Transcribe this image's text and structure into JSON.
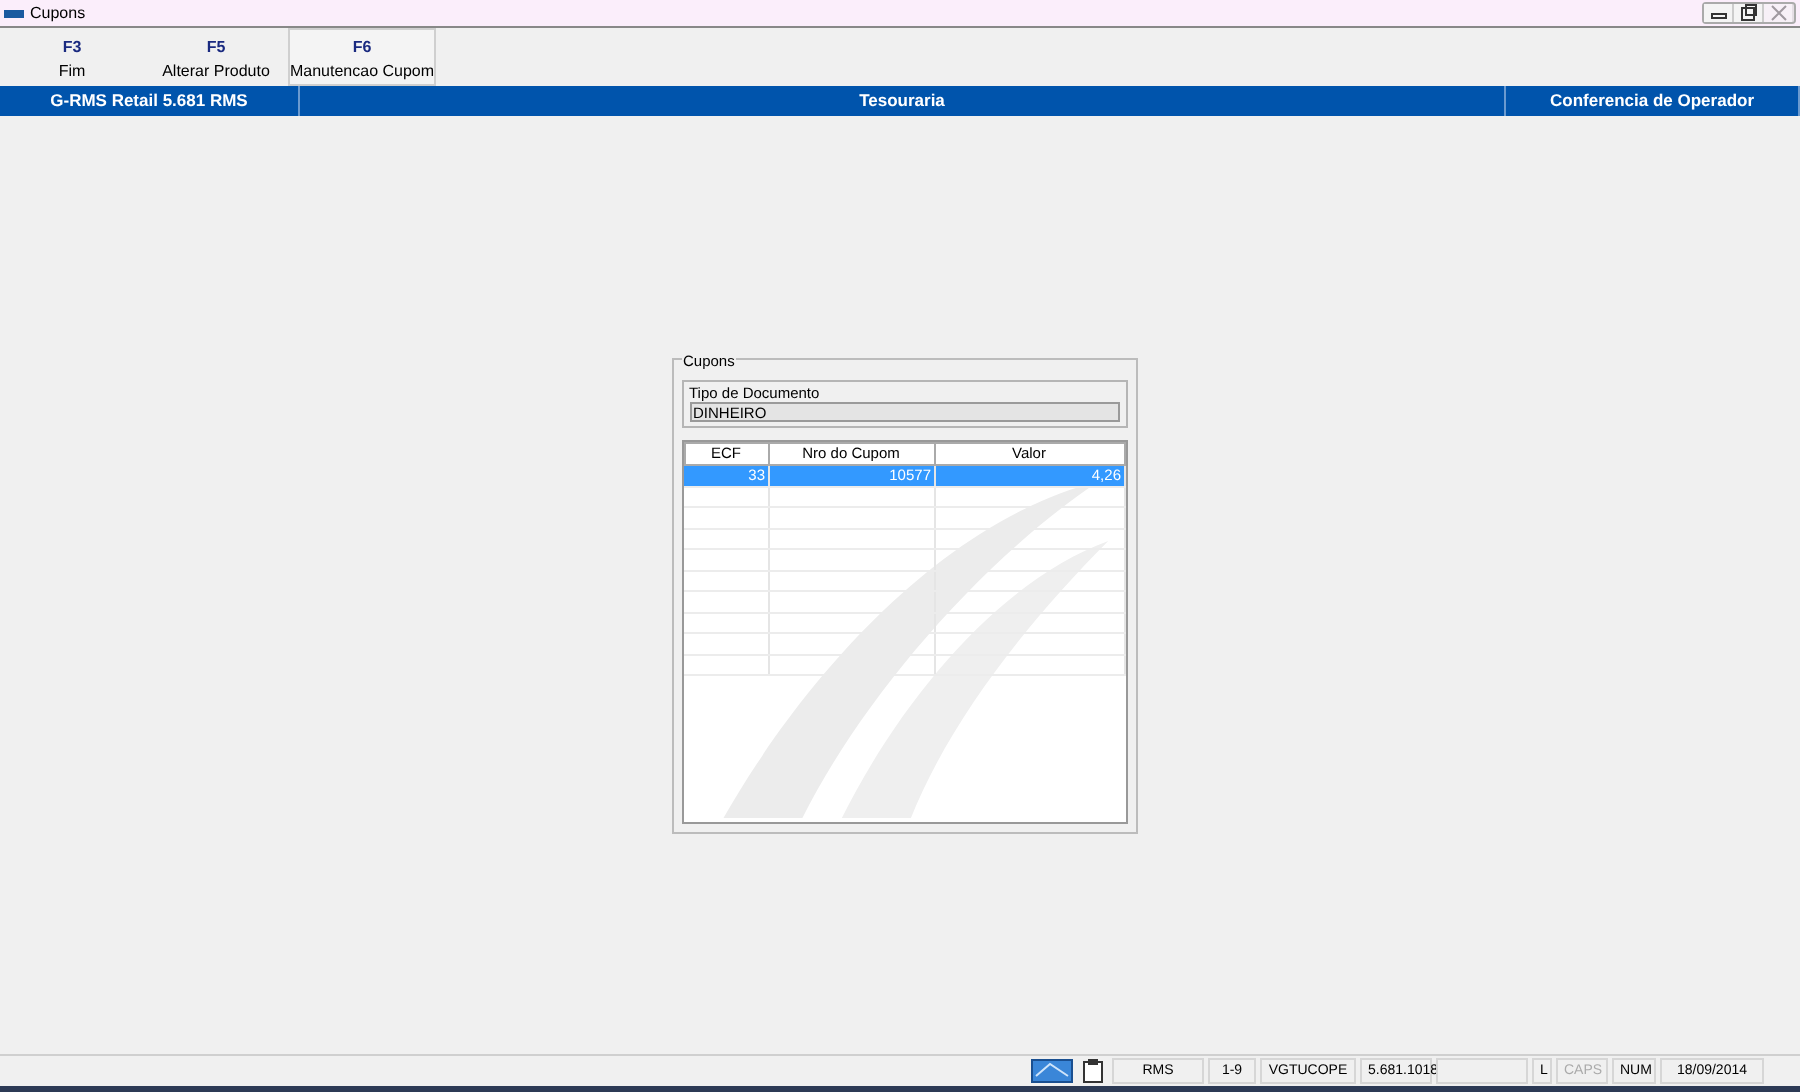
{
  "window": {
    "title": "Cupons",
    "buttons": [
      {
        "kind": "minimize",
        "disabled": false
      },
      {
        "kind": "restore",
        "disabled": false
      },
      {
        "kind": "close",
        "disabled": true
      }
    ]
  },
  "toolbar": [
    {
      "key": "F3",
      "label": "Fim",
      "selected": false
    },
    {
      "key": "F5",
      "label": "Alterar Produto",
      "selected": false
    },
    {
      "key": "F6",
      "label": "Manutencao Cupom",
      "selected": true
    }
  ],
  "header": {
    "app": "G-RMS Retail 5.681 RMS",
    "module": "Tesouraria",
    "screen": "Conferencia de Operador"
  },
  "group": {
    "title": "Cupons",
    "field": {
      "label": "Tipo de Documento",
      "value": "DINHEIRO"
    },
    "table": {
      "columns": [
        "ECF",
        "Nro do Cupom",
        "Valor"
      ],
      "rows": [
        {
          "cells": [
            "33",
            "10577",
            "4,26"
          ],
          "selected": true
        }
      ]
    }
  },
  "status_bar": [
    {
      "text": "RMS",
      "disabled": false
    },
    {
      "text": "1-9",
      "disabled": false
    },
    {
      "text": "VGTUCOPE",
      "disabled": false
    },
    {
      "text": "5.681.1018",
      "disabled": false
    },
    {
      "disabled": false
    },
    {
      "text": "L",
      "disabled": false
    },
    {
      "text": "CAPS",
      "disabled": true
    },
    {
      "text": "NUM",
      "disabled": false
    },
    {
      "text": "18/09/2014",
      "disabled": false
    }
  ]
}
